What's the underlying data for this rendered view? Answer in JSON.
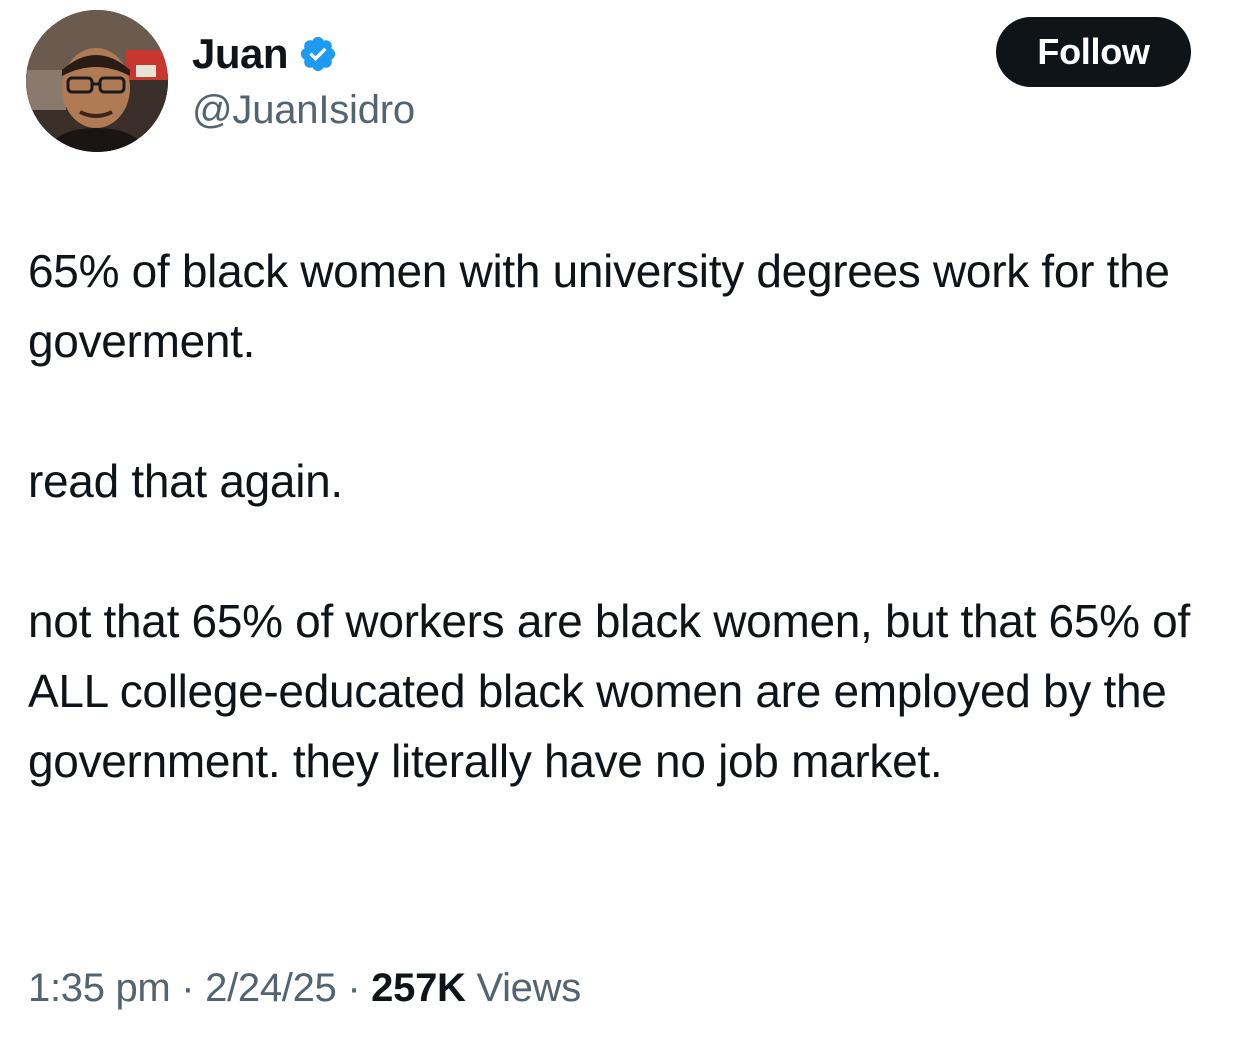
{
  "author": {
    "display_name": "Juan",
    "handle": "@JuanIsidro",
    "verified_icon": "verified-badge-icon",
    "badge_color": "#1d9bf0"
  },
  "follow_button": {
    "label": "Follow"
  },
  "tweet": {
    "paragraphs": [
      "65% of black women with university degrees work for the goverment.",
      "read that again.",
      "not that 65% of workers are black women, but that 65% of ALL college-educated black women are employed by the government. they literally have no job market."
    ]
  },
  "meta": {
    "time": "1:35 pm",
    "separator": "·",
    "date": "2/24/25",
    "views_count": "257K",
    "views_label": "Views"
  },
  "colors": {
    "text_primary": "#0f1419",
    "text_secondary": "#536471",
    "button_bg": "#0f1419",
    "accent": "#1d9bf0"
  }
}
